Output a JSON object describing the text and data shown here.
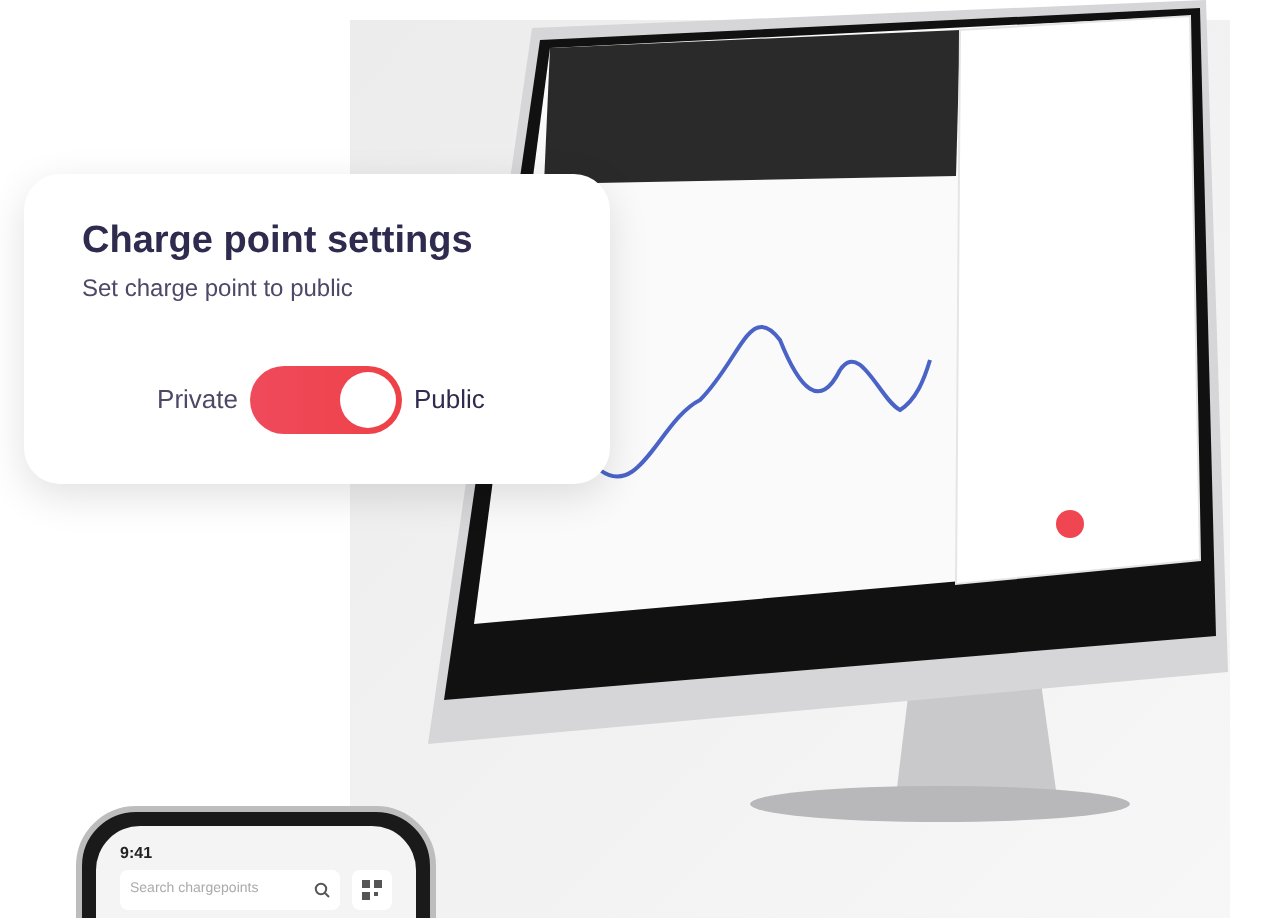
{
  "settings_card": {
    "title": "Charge point settings",
    "subtitle": "Set charge point to public",
    "toggle": {
      "off_label": "Private",
      "on_label": "Public",
      "on": true
    }
  },
  "phone": {
    "time": "9:41",
    "search": {
      "placeholder": "Search chargepoints"
    }
  }
}
